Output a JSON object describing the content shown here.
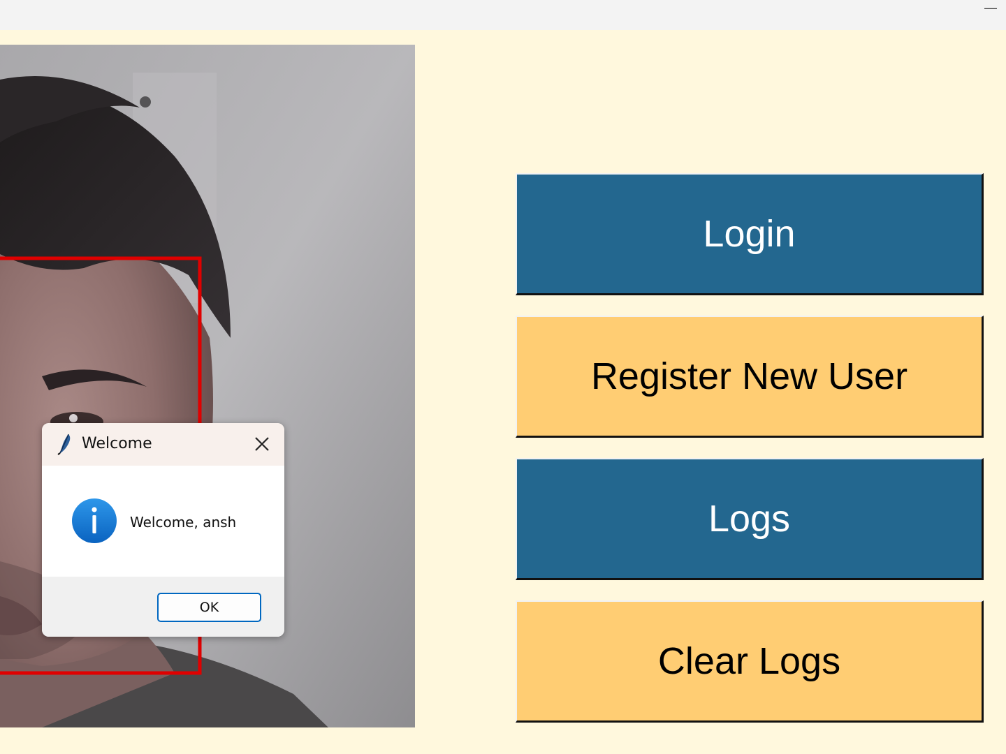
{
  "window": {
    "minimize_glyph": "—"
  },
  "buttons": {
    "login": "Login",
    "register": "Register New User",
    "logs": "Logs",
    "clear_logs": "Clear Logs"
  },
  "dialog": {
    "title": "Welcome",
    "message": "Welcome, ansh",
    "ok_label": "OK",
    "icon": "info-icon"
  },
  "colors": {
    "background": "#fff8dd",
    "button_blue": "#23678f",
    "button_yellow": "#ffcd73",
    "face_box": "#e00000",
    "info_icon": "#1177d4"
  }
}
